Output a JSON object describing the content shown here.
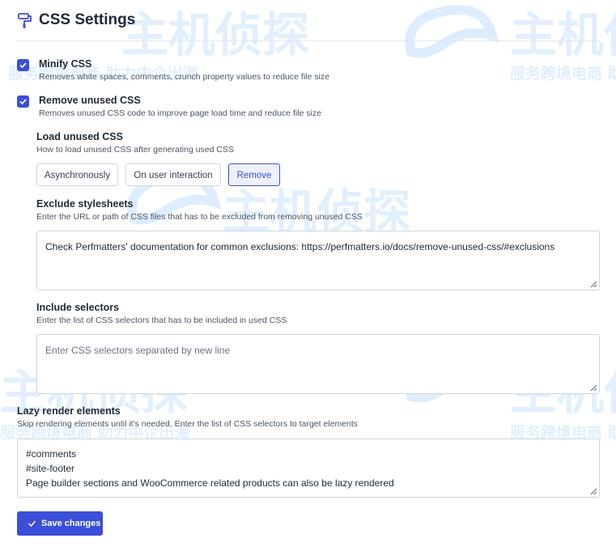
{
  "header": {
    "title": "CSS Settings",
    "icon": "paint-roller-icon"
  },
  "minify": {
    "label": "Minify CSS",
    "desc": "Removes white spaces, comments, crunch property values to reduce file size",
    "checked": true
  },
  "remove_unused": {
    "label": "Remove unused CSS",
    "desc": "Removes unused CSS code to improve page load time and reduce file size",
    "checked": true
  },
  "load_unused": {
    "label": "Load unused CSS",
    "desc": "How to load unused CSS after generating used CSS",
    "options": [
      "Asynchronously",
      "On user interaction",
      "Remove"
    ],
    "selected": "Remove"
  },
  "exclude": {
    "label": "Exclude stylesheets",
    "desc": "Enter the URL or path of CSS files that has to be excluded from removing unused CSS",
    "value": "Check Perfmatters' documentation for common exclusions: https://perfmatters.io/docs/remove-unused-css/#exclusions"
  },
  "include": {
    "label": "Include selectors",
    "desc": "Enter the list of CSS selectors that has to be included in used CSS",
    "placeholder": "Enter CSS selectors separated by new line"
  },
  "lazy": {
    "label": "Lazy render elements",
    "desc": "Skip rendering elements until it's needed. Enter the list of CSS selectors to target elements",
    "lines": [
      "#comments",
      "#site-footer",
      "Page builder sections and WooCommerce related products can also be lazy rendered"
    ]
  },
  "save_label": "Save changes",
  "watermark": {
    "logo": "主机侦探",
    "slogan": "服务跨境电商 助力中企出海"
  },
  "colors": {
    "accent": "#3b4fd8",
    "border": "#d1d5db",
    "text": "#1f2937"
  }
}
